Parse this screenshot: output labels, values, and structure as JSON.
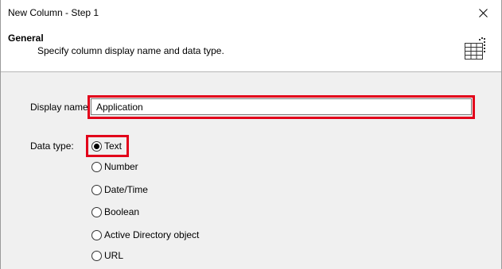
{
  "window": {
    "title": "New Column - Step 1"
  },
  "header": {
    "heading": "General",
    "subheading": "Specify column display name and data type.",
    "icon": "table-columns-icon"
  },
  "form": {
    "display_name_label": "Display name:",
    "display_name_value": "Application",
    "data_type_label": "Data type:",
    "data_types": [
      {
        "label": "Text",
        "checked": true
      },
      {
        "label": "Number",
        "checked": false
      },
      {
        "label": "Date/Time",
        "checked": false
      },
      {
        "label": "Boolean",
        "checked": false
      },
      {
        "label": "Active Directory object",
        "checked": false
      },
      {
        "label": "URL",
        "checked": false
      }
    ]
  },
  "colors": {
    "highlight": "#e2001a",
    "background": "#f0f0f0",
    "header_background": "#ffffff"
  }
}
